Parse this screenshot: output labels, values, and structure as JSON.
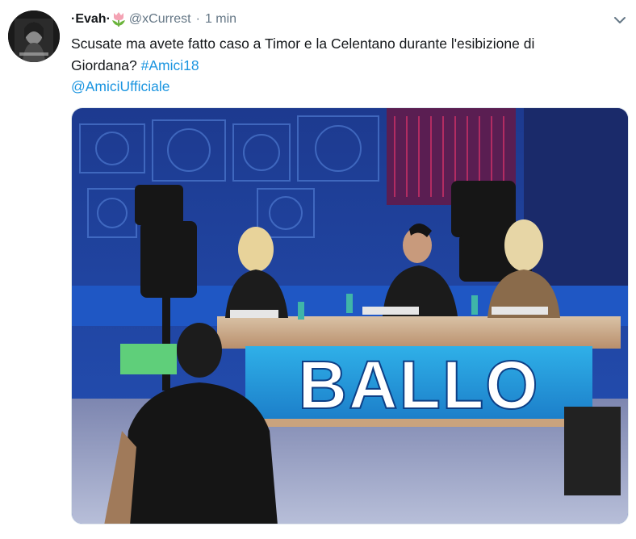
{
  "tweet": {
    "display_name": "·Evah·",
    "handle": "@xCurrest",
    "separator": "·",
    "time": "1 min",
    "text_prefix": "Scusate ma avete fatto caso a Timor e la Celentano durante l'esibizione di Giordana? ",
    "hashtag": "#Amici18",
    "mention": "@AmiciUfficiale",
    "emoji_icon": "tulip-icon",
    "menu_icon": "chevron-down-icon"
  },
  "media": {
    "desk_sign": "BALLO"
  },
  "colors": {
    "link": "#1b95e0",
    "secondary_text": "#657786"
  }
}
